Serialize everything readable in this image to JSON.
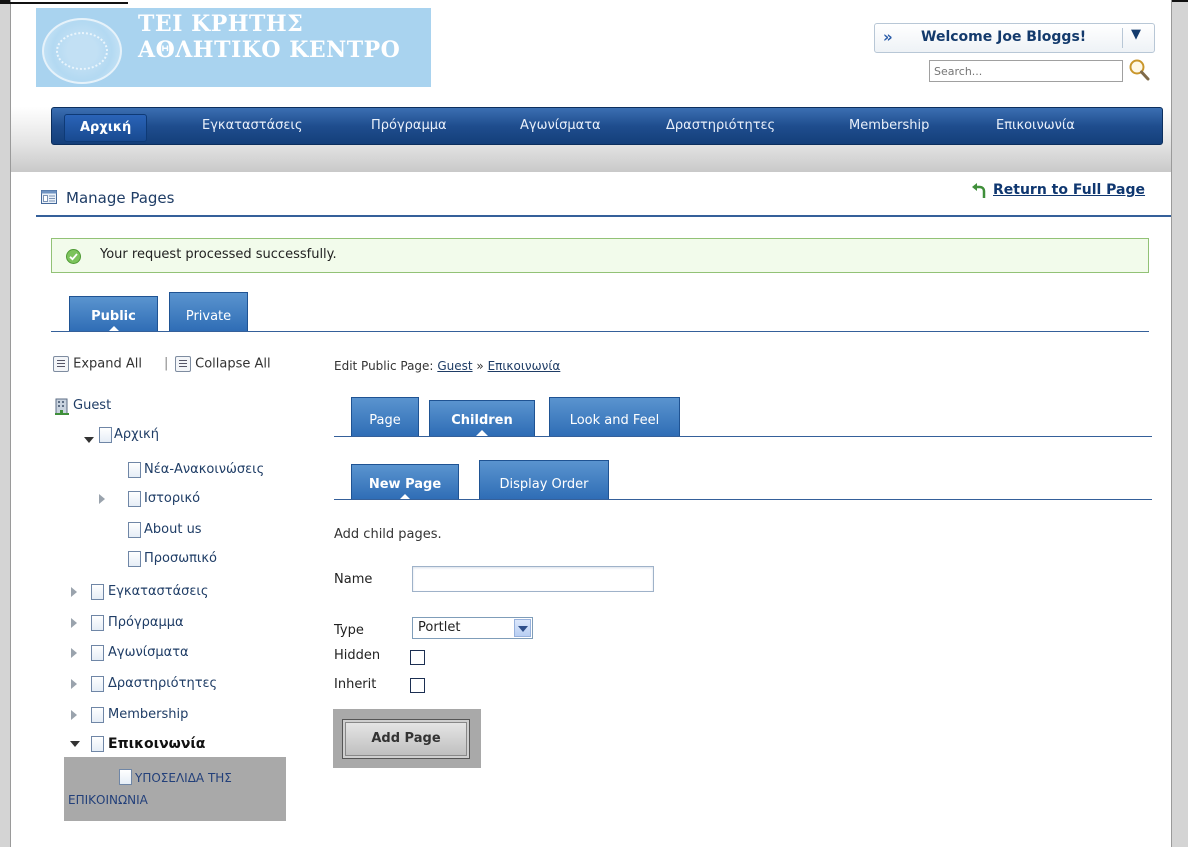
{
  "site": {
    "logo_line1": "ΤΕΙ ΚΡΗΤΗΣ",
    "logo_line2": "ΑΘΛΗΤΙΚΟ ΚΕΝΤΡΟ"
  },
  "user_menu": {
    "arrows": "»",
    "welcome": "Welcome Joe Bloggs!",
    "dropdown": "▼"
  },
  "search": {
    "placeholder": "Search..."
  },
  "nav": {
    "items": [
      "Αρχική",
      "Εγκαταστάσεις",
      "Πρόγραμμα",
      "Αγωνίσματα",
      "Δραστηριότητες",
      "Membership",
      "Επικοινωνία"
    ]
  },
  "page": {
    "title": "Manage Pages",
    "return_link": "Return to Full Page",
    "success_message": "Your request processed successfully."
  },
  "layout_tabs": [
    "Public",
    "Private"
  ],
  "tree": {
    "expand_all": "Expand All",
    "separator": "|",
    "collapse_all": "Collapse All",
    "root": "Guest",
    "nodes": [
      "Αρχική",
      "Νέα-Ανακοινώσεις",
      "Ιστορικό",
      "About us",
      "Προσωπικό",
      "Εγκαταστάσεις",
      "Πρόγραμμα",
      "Αγωνίσματα",
      "Δραστηριότητες",
      "Membership",
      "Επικοινωνία"
    ],
    "highlighted_child_line1": "ΥΠΟΣΕΛΙΔΑ ΤΗΣ",
    "highlighted_child_line2": "ΕΠΙΚΟΙΝΩΝΙΑ"
  },
  "edit": {
    "prefix": "Edit Public Page:",
    "crumb_guest": "Guest",
    "crumb_sep": "»",
    "crumb_page": "Επικοινωνία",
    "tabs": [
      "Page",
      "Children",
      "Look and Feel"
    ],
    "subtabs": [
      "New Page",
      "Display Order"
    ],
    "instruction": "Add child pages."
  },
  "form": {
    "name_label": "Name",
    "name_value": "",
    "type_label": "Type",
    "type_value": "Portlet",
    "hidden_label": "Hidden",
    "hidden_checked": false,
    "inherit_label": "Inherit",
    "inherit_checked": false,
    "submit": "Add Page"
  }
}
